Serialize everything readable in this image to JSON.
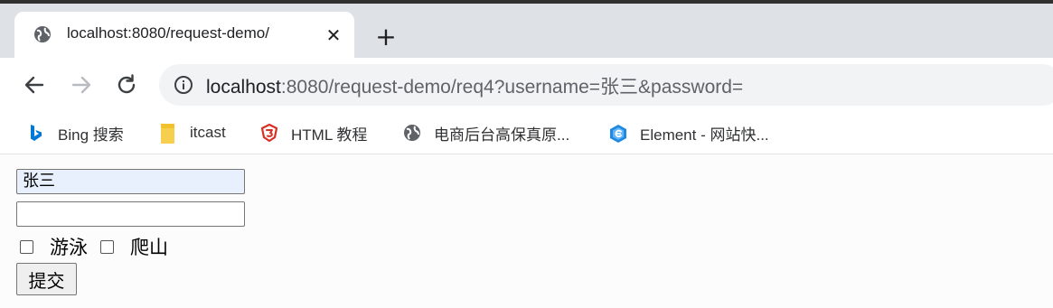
{
  "browser": {
    "tab": {
      "title": "localhost:8080/request-demo/",
      "close": "✕"
    },
    "new_tab": "+",
    "address": {
      "host": "localhost",
      "rest": ":8080/request-demo/req4?username=张三&password="
    },
    "bookmarks": [
      {
        "label": "Bing 搜索",
        "icon": "bing-icon",
        "color": "#0078d4"
      },
      {
        "label": "itcast",
        "icon": "folder-icon",
        "color": "#f6cf4f"
      },
      {
        "label": "HTML 教程",
        "icon": "html-tutorial-icon",
        "color": "#d93025"
      },
      {
        "label": "电商后台高保真原...",
        "icon": "globe-icon",
        "color": "#5f6368"
      },
      {
        "label": "Element - 网站快...",
        "icon": "element-icon",
        "color": "#1e88e5"
      }
    ]
  },
  "form": {
    "username": "张三",
    "password": "",
    "hobbies": [
      "游泳",
      "爬山"
    ],
    "submit": "提交"
  }
}
